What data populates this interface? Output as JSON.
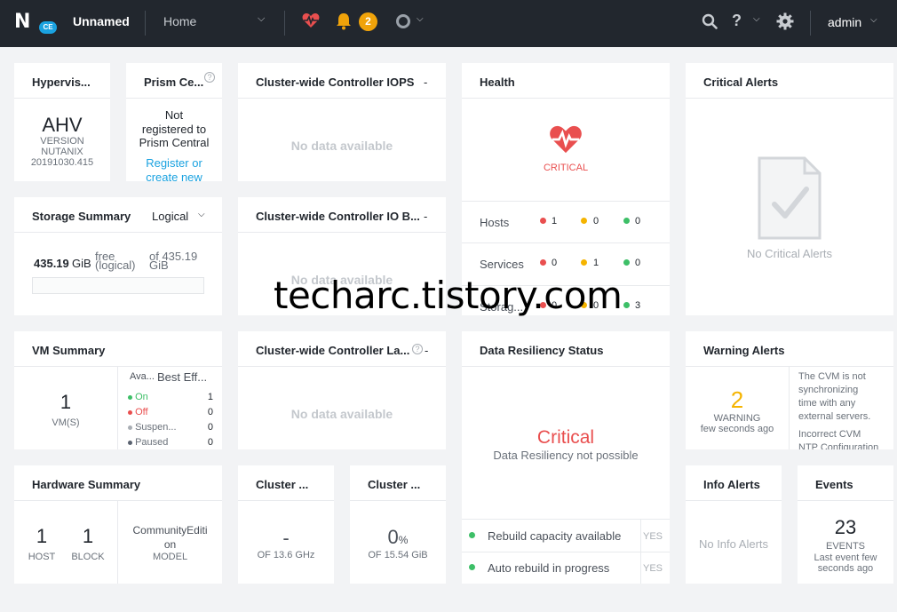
{
  "topbar": {
    "logo_letter": "N",
    "logo_badge": "CE",
    "cluster_name": "Unnamed",
    "nav_home": "Home",
    "alert_count": "2",
    "user": "admin"
  },
  "hypervisor": {
    "title": "Hypervis...",
    "name": "AHV",
    "version_label": "VERSION",
    "vendor": "NUTANIX",
    "version": "20191030.415"
  },
  "prism": {
    "title": "Prism Ce...",
    "status_line1": "Not",
    "status_line2": "registered to",
    "status_line3": "Prism Central",
    "link_line1": "Register or",
    "link_line2": "create new"
  },
  "iops": {
    "title": "Cluster-wide Controller IOPS",
    "suffix": "-",
    "empty": "No data available"
  },
  "health": {
    "title": "Health",
    "status": "CRITICAL",
    "rows": [
      {
        "label": "Hosts",
        "red": "1",
        "yellow": "0",
        "green": "0"
      },
      {
        "label": "Services",
        "red": "0",
        "yellow": "1",
        "green": "0"
      },
      {
        "label": "Storag...",
        "red": "0",
        "yellow": "0",
        "green": "3"
      }
    ]
  },
  "critical_alerts": {
    "title": "Critical Alerts",
    "empty": "No Critical Alerts"
  },
  "storage": {
    "title": "Storage Summary",
    "mode": "Logical",
    "free_value": "435.19",
    "free_unit": "GiB",
    "free_label1": "free",
    "free_label2": "(logical)",
    "total_label1": "of 435.19",
    "total_label2": "GiB",
    "used_fraction": 0.0
  },
  "iob": {
    "title": "Cluster-wide Controller IO B...",
    "suffix": "-",
    "empty": "No data available"
  },
  "vm": {
    "title": "VM Summary",
    "count": "1",
    "count_label": "VM(S)",
    "col1": "Ava...",
    "col2": "Best Eff...",
    "states": [
      {
        "label": "On",
        "value": "1"
      },
      {
        "label": "Off",
        "value": "0"
      },
      {
        "label": "Suspen...",
        "value": "0"
      },
      {
        "label": "Paused",
        "value": "0"
      }
    ]
  },
  "latency": {
    "title": "Cluster-wide Controller La...",
    "suffix": "-",
    "empty": "No data available"
  },
  "resiliency": {
    "title": "Data Resiliency Status",
    "status": "Critical",
    "subtitle": "Data Resiliency not possible",
    "rows": [
      {
        "label": "Rebuild capacity available",
        "value": "YES"
      },
      {
        "label": "Auto rebuild in progress",
        "value": "YES"
      }
    ]
  },
  "warning": {
    "title": "Warning Alerts",
    "count": "2",
    "label": "WARNING",
    "time": "few seconds ago",
    "msg1_l1": "The CVM is not",
    "msg1_l2": "synchronizing",
    "msg1_l3": "time with any",
    "msg1_l4": "external servers.",
    "msg2_l1": "Incorrect CVM",
    "msg2_l2": "NTP Configuration"
  },
  "hardware": {
    "title": "Hardware Summary",
    "hosts": "1",
    "hosts_label": "HOST",
    "blocks": "1",
    "blocks_label": "BLOCK",
    "model_l1": "CommunityEditi",
    "model_l2": "on",
    "model_label": "MODEL"
  },
  "cpu": {
    "title": "Cluster ...",
    "value": "-",
    "total": "OF 13.6 GHz"
  },
  "memory": {
    "title": "Cluster ...",
    "value": "0",
    "unit": "%",
    "total": "OF 15.54 GiB"
  },
  "info": {
    "title": "Info Alerts",
    "empty": "No Info Alerts"
  },
  "events": {
    "title": "Events",
    "count": "23",
    "label": "EVENTS",
    "time_l1": "Last event few",
    "time_l2": "seconds ago"
  },
  "watermark": "techarc.tistory.com",
  "colors": {
    "topbar": "#22272e",
    "critical": "#e94f4f",
    "warning": "#f5b400",
    "ok": "#3dbf67",
    "link": "#1aa2e0"
  }
}
